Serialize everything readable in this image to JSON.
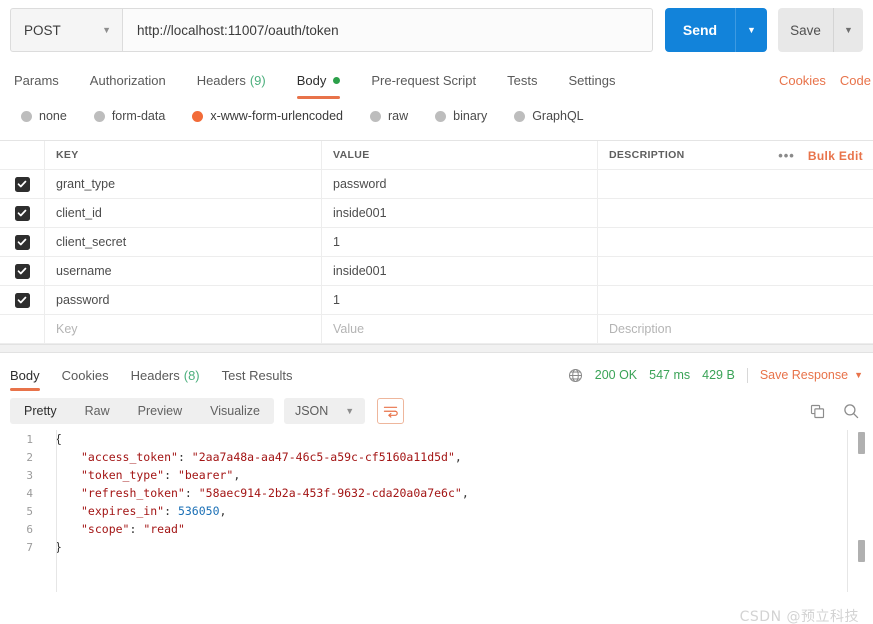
{
  "request": {
    "method": "POST",
    "url": "http://localhost:11007/oauth/token",
    "send_label": "Send",
    "save_label": "Save",
    "tabs": [
      {
        "label": "Params",
        "count": "",
        "active": false,
        "dot": false
      },
      {
        "label": "Authorization",
        "count": "",
        "active": false,
        "dot": false
      },
      {
        "label": "Headers",
        "count": "(9)",
        "active": false,
        "dot": false
      },
      {
        "label": "Body",
        "count": "",
        "active": true,
        "dot": true
      },
      {
        "label": "Pre-request Script",
        "count": "",
        "active": false,
        "dot": false
      },
      {
        "label": "Tests",
        "count": "",
        "active": false,
        "dot": false
      },
      {
        "label": "Settings",
        "count": "",
        "active": false,
        "dot": false
      }
    ],
    "cookies_link": "Cookies",
    "code_link": "Code",
    "body_types": [
      {
        "label": "none",
        "selected": false
      },
      {
        "label": "form-data",
        "selected": false
      },
      {
        "label": "x-www-form-urlencoded",
        "selected": true
      },
      {
        "label": "raw",
        "selected": false
      },
      {
        "label": "binary",
        "selected": false
      },
      {
        "label": "GraphQL",
        "selected": false
      }
    ],
    "table": {
      "headers": {
        "key": "KEY",
        "value": "VALUE",
        "description": "DESCRIPTION"
      },
      "bulk_edit": "Bulk Edit",
      "more_actions": "•••",
      "rows": [
        {
          "checked": true,
          "key": "grant_type",
          "value": "password",
          "description": ""
        },
        {
          "checked": true,
          "key": "client_id",
          "value": "inside001",
          "description": ""
        },
        {
          "checked": true,
          "key": "client_secret",
          "value": "1",
          "description": ""
        },
        {
          "checked": true,
          "key": "username",
          "value": "inside001",
          "description": ""
        },
        {
          "checked": true,
          "key": "password",
          "value": "1",
          "description": ""
        }
      ],
      "placeholder_row": {
        "key": "Key",
        "value": "Value",
        "description": "Description"
      }
    }
  },
  "response": {
    "tabs": [
      {
        "label": "Body",
        "count": "",
        "active": true
      },
      {
        "label": "Cookies",
        "count": "",
        "active": false
      },
      {
        "label": "Headers",
        "count": "(8)",
        "active": false
      },
      {
        "label": "Test Results",
        "count": "",
        "active": false
      }
    ],
    "status": "200 OK",
    "time": "547 ms",
    "size": "429 B",
    "save_response": "Save Response",
    "view_modes": [
      {
        "label": "Pretty",
        "active": true
      },
      {
        "label": "Raw",
        "active": false
      },
      {
        "label": "Preview",
        "active": false
      },
      {
        "label": "Visualize",
        "active": false
      }
    ],
    "format": "JSON",
    "body_lines": [
      {
        "no": "1",
        "indent": 0,
        "segments": [
          {
            "t": "{",
            "c": "jpunc"
          }
        ]
      },
      {
        "no": "2",
        "indent": 1,
        "segments": [
          {
            "t": "\"access_token\"",
            "c": "jkey"
          },
          {
            "t": ": ",
            "c": "jpunc"
          },
          {
            "t": "\"2aa7a48a-aa47-46c5-a59c-cf5160a11d5d\"",
            "c": "jstr"
          },
          {
            "t": ",",
            "c": "jpunc"
          }
        ]
      },
      {
        "no": "3",
        "indent": 1,
        "segments": [
          {
            "t": "\"token_type\"",
            "c": "jkey"
          },
          {
            "t": ": ",
            "c": "jpunc"
          },
          {
            "t": "\"bearer\"",
            "c": "jstr"
          },
          {
            "t": ",",
            "c": "jpunc"
          }
        ]
      },
      {
        "no": "4",
        "indent": 1,
        "segments": [
          {
            "t": "\"refresh_token\"",
            "c": "jkey"
          },
          {
            "t": ": ",
            "c": "jpunc"
          },
          {
            "t": "\"58aec914-2b2a-453f-9632-cda20a0a7e6c\"",
            "c": "jstr"
          },
          {
            "t": ",",
            "c": "jpunc"
          }
        ]
      },
      {
        "no": "5",
        "indent": 1,
        "segments": [
          {
            "t": "\"expires_in\"",
            "c": "jkey"
          },
          {
            "t": ": ",
            "c": "jpunc"
          },
          {
            "t": "536050",
            "c": "jnum"
          },
          {
            "t": ",",
            "c": "jpunc"
          }
        ]
      },
      {
        "no": "6",
        "indent": 1,
        "segments": [
          {
            "t": "\"scope\"",
            "c": "jkey"
          },
          {
            "t": ": ",
            "c": "jpunc"
          },
          {
            "t": "\"read\"",
            "c": "jstr"
          }
        ]
      },
      {
        "no": "7",
        "indent": 0,
        "segments": [
          {
            "t": "}",
            "c": "jpunc"
          }
        ]
      }
    ]
  },
  "watermark": "CSDN @预立科技"
}
